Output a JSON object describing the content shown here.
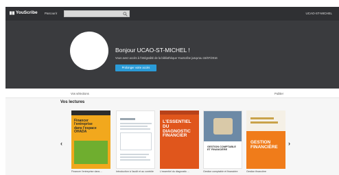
{
  "header": {
    "logo_text": "YouScribe",
    "nav_link": "Parcourir",
    "search_placeholder": "",
    "user_menu": "UCAO-ST-MICHEL"
  },
  "hero": {
    "greeting": "Bonjour UCAO-ST-MICHEL !",
    "access_text": "Vous avez accès à l'intégralité de la bibliothèque YouScribe jusqu'au 15/07/2016",
    "extend_button": "Prolonger votre accès"
  },
  "tabs": [
    "Vos sélections",
    "Publier"
  ],
  "lectures": {
    "title": "Vos lectures",
    "books": [
      {
        "caption": "Financer l'entreprise dans ...",
        "cover_lines": [
          "Financer",
          "l'entreprise",
          "dans l'espace",
          "OHADA"
        ],
        "colors": {
          "bg": "#f2a81d",
          "accent": "#6fae2f"
        }
      },
      {
        "caption": "Introduction à l'audit et au contrôle",
        "cover_lines": [],
        "colors": {
          "bg": "#ffffff",
          "accent": "#cfd6dc"
        }
      },
      {
        "caption": "L'essentiel du diagnostic ...",
        "cover_lines": [
          "L'ESSENTIEL",
          "DU",
          "DIAGNOSTIC",
          "FINANCIER"
        ],
        "colors": {
          "bg": "#e0561c",
          "accent": "#ffffff"
        }
      },
      {
        "caption": "Gestion comptable et financière",
        "cover_lines": [
          "GESTION COMPTABLE",
          "ET FINANCIÈRE"
        ],
        "colors": {
          "bg": "#ffffff",
          "accent": "#4a7aa6"
        }
      },
      {
        "caption": "Gestion financière",
        "cover_lines": [
          "GESTION",
          "FINANCIÈRE"
        ],
        "colors": {
          "bg": "#f07c1a",
          "accent": "#ffffff"
        }
      }
    ]
  },
  "colors": {
    "topbar": "#2f3033",
    "hero": "#3a3b3e",
    "button": "#2a9bd8"
  },
  "icons": [
    "logo-icon",
    "search-icon",
    "chevron-left-icon",
    "chevron-right-icon"
  ]
}
